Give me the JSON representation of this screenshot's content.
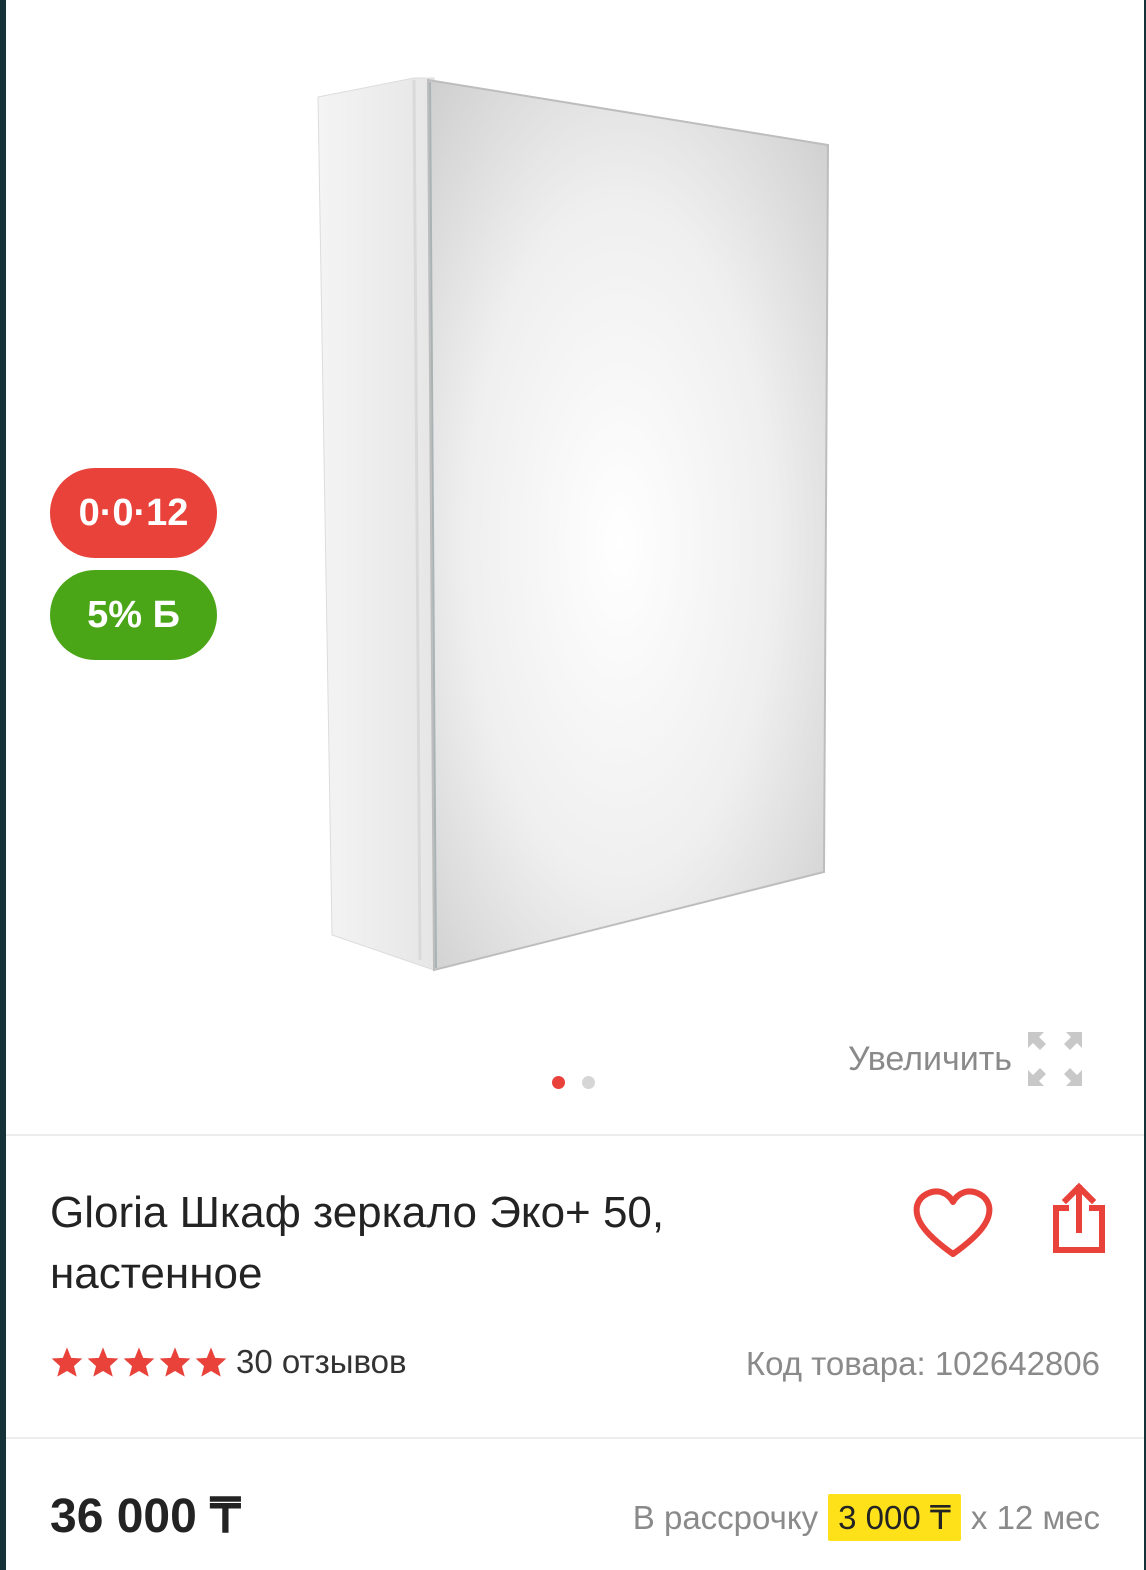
{
  "gallery": {
    "badges": {
      "installment": "0·0·12",
      "bonus": "5% Б"
    },
    "zoom_label": "Увеличить",
    "slides_total": 2,
    "slide_active": 1
  },
  "product": {
    "title": "Gloria Шкаф зеркало Эко+ 50, настенное",
    "rating": 5,
    "reviews_label": "30 отзывов",
    "sku_label": "Код товара: 102642806"
  },
  "price": {
    "value": "36 000 ₸",
    "installment_prefix": "В рассрочку",
    "installment_amount": "3 000 ₸",
    "installment_suffix": "x 12 мес"
  },
  "colors": {
    "accent_red": "#e8423b",
    "bonus_green": "#4aa517",
    "highlight_yellow": "#ffe11a"
  },
  "icons": [
    "expand-icon",
    "heart-icon",
    "share-icon",
    "star-icon"
  ]
}
